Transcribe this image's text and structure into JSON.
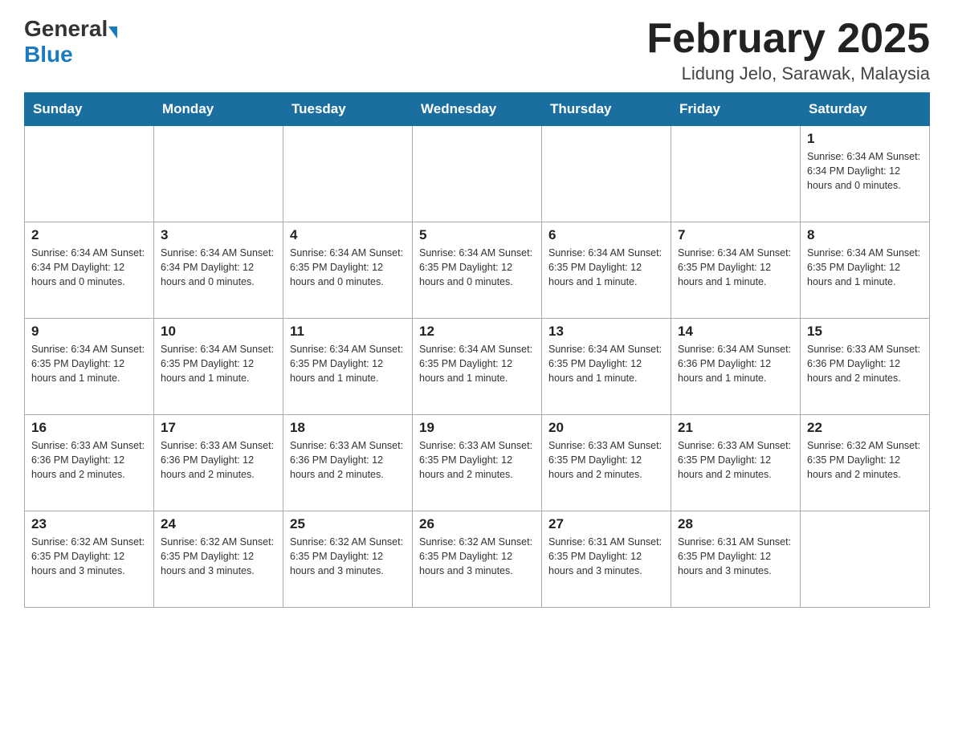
{
  "header": {
    "logo_general": "General",
    "logo_blue": "Blue",
    "title": "February 2025",
    "subtitle": "Lidung Jelo, Sarawak, Malaysia"
  },
  "weekdays": [
    "Sunday",
    "Monday",
    "Tuesday",
    "Wednesday",
    "Thursday",
    "Friday",
    "Saturday"
  ],
  "weeks": [
    [
      {
        "day": "",
        "info": ""
      },
      {
        "day": "",
        "info": ""
      },
      {
        "day": "",
        "info": ""
      },
      {
        "day": "",
        "info": ""
      },
      {
        "day": "",
        "info": ""
      },
      {
        "day": "",
        "info": ""
      },
      {
        "day": "1",
        "info": "Sunrise: 6:34 AM\nSunset: 6:34 PM\nDaylight: 12 hours\nand 0 minutes."
      }
    ],
    [
      {
        "day": "2",
        "info": "Sunrise: 6:34 AM\nSunset: 6:34 PM\nDaylight: 12 hours\nand 0 minutes."
      },
      {
        "day": "3",
        "info": "Sunrise: 6:34 AM\nSunset: 6:34 PM\nDaylight: 12 hours\nand 0 minutes."
      },
      {
        "day": "4",
        "info": "Sunrise: 6:34 AM\nSunset: 6:35 PM\nDaylight: 12 hours\nand 0 minutes."
      },
      {
        "day": "5",
        "info": "Sunrise: 6:34 AM\nSunset: 6:35 PM\nDaylight: 12 hours\nand 0 minutes."
      },
      {
        "day": "6",
        "info": "Sunrise: 6:34 AM\nSunset: 6:35 PM\nDaylight: 12 hours\nand 1 minute."
      },
      {
        "day": "7",
        "info": "Sunrise: 6:34 AM\nSunset: 6:35 PM\nDaylight: 12 hours\nand 1 minute."
      },
      {
        "day": "8",
        "info": "Sunrise: 6:34 AM\nSunset: 6:35 PM\nDaylight: 12 hours\nand 1 minute."
      }
    ],
    [
      {
        "day": "9",
        "info": "Sunrise: 6:34 AM\nSunset: 6:35 PM\nDaylight: 12 hours\nand 1 minute."
      },
      {
        "day": "10",
        "info": "Sunrise: 6:34 AM\nSunset: 6:35 PM\nDaylight: 12 hours\nand 1 minute."
      },
      {
        "day": "11",
        "info": "Sunrise: 6:34 AM\nSunset: 6:35 PM\nDaylight: 12 hours\nand 1 minute."
      },
      {
        "day": "12",
        "info": "Sunrise: 6:34 AM\nSunset: 6:35 PM\nDaylight: 12 hours\nand 1 minute."
      },
      {
        "day": "13",
        "info": "Sunrise: 6:34 AM\nSunset: 6:35 PM\nDaylight: 12 hours\nand 1 minute."
      },
      {
        "day": "14",
        "info": "Sunrise: 6:34 AM\nSunset: 6:36 PM\nDaylight: 12 hours\nand 1 minute."
      },
      {
        "day": "15",
        "info": "Sunrise: 6:33 AM\nSunset: 6:36 PM\nDaylight: 12 hours\nand 2 minutes."
      }
    ],
    [
      {
        "day": "16",
        "info": "Sunrise: 6:33 AM\nSunset: 6:36 PM\nDaylight: 12 hours\nand 2 minutes."
      },
      {
        "day": "17",
        "info": "Sunrise: 6:33 AM\nSunset: 6:36 PM\nDaylight: 12 hours\nand 2 minutes."
      },
      {
        "day": "18",
        "info": "Sunrise: 6:33 AM\nSunset: 6:36 PM\nDaylight: 12 hours\nand 2 minutes."
      },
      {
        "day": "19",
        "info": "Sunrise: 6:33 AM\nSunset: 6:35 PM\nDaylight: 12 hours\nand 2 minutes."
      },
      {
        "day": "20",
        "info": "Sunrise: 6:33 AM\nSunset: 6:35 PM\nDaylight: 12 hours\nand 2 minutes."
      },
      {
        "day": "21",
        "info": "Sunrise: 6:33 AM\nSunset: 6:35 PM\nDaylight: 12 hours\nand 2 minutes."
      },
      {
        "day": "22",
        "info": "Sunrise: 6:32 AM\nSunset: 6:35 PM\nDaylight: 12 hours\nand 2 minutes."
      }
    ],
    [
      {
        "day": "23",
        "info": "Sunrise: 6:32 AM\nSunset: 6:35 PM\nDaylight: 12 hours\nand 3 minutes."
      },
      {
        "day": "24",
        "info": "Sunrise: 6:32 AM\nSunset: 6:35 PM\nDaylight: 12 hours\nand 3 minutes."
      },
      {
        "day": "25",
        "info": "Sunrise: 6:32 AM\nSunset: 6:35 PM\nDaylight: 12 hours\nand 3 minutes."
      },
      {
        "day": "26",
        "info": "Sunrise: 6:32 AM\nSunset: 6:35 PM\nDaylight: 12 hours\nand 3 minutes."
      },
      {
        "day": "27",
        "info": "Sunrise: 6:31 AM\nSunset: 6:35 PM\nDaylight: 12 hours\nand 3 minutes."
      },
      {
        "day": "28",
        "info": "Sunrise: 6:31 AM\nSunset: 6:35 PM\nDaylight: 12 hours\nand 3 minutes."
      },
      {
        "day": "",
        "info": ""
      }
    ]
  ]
}
